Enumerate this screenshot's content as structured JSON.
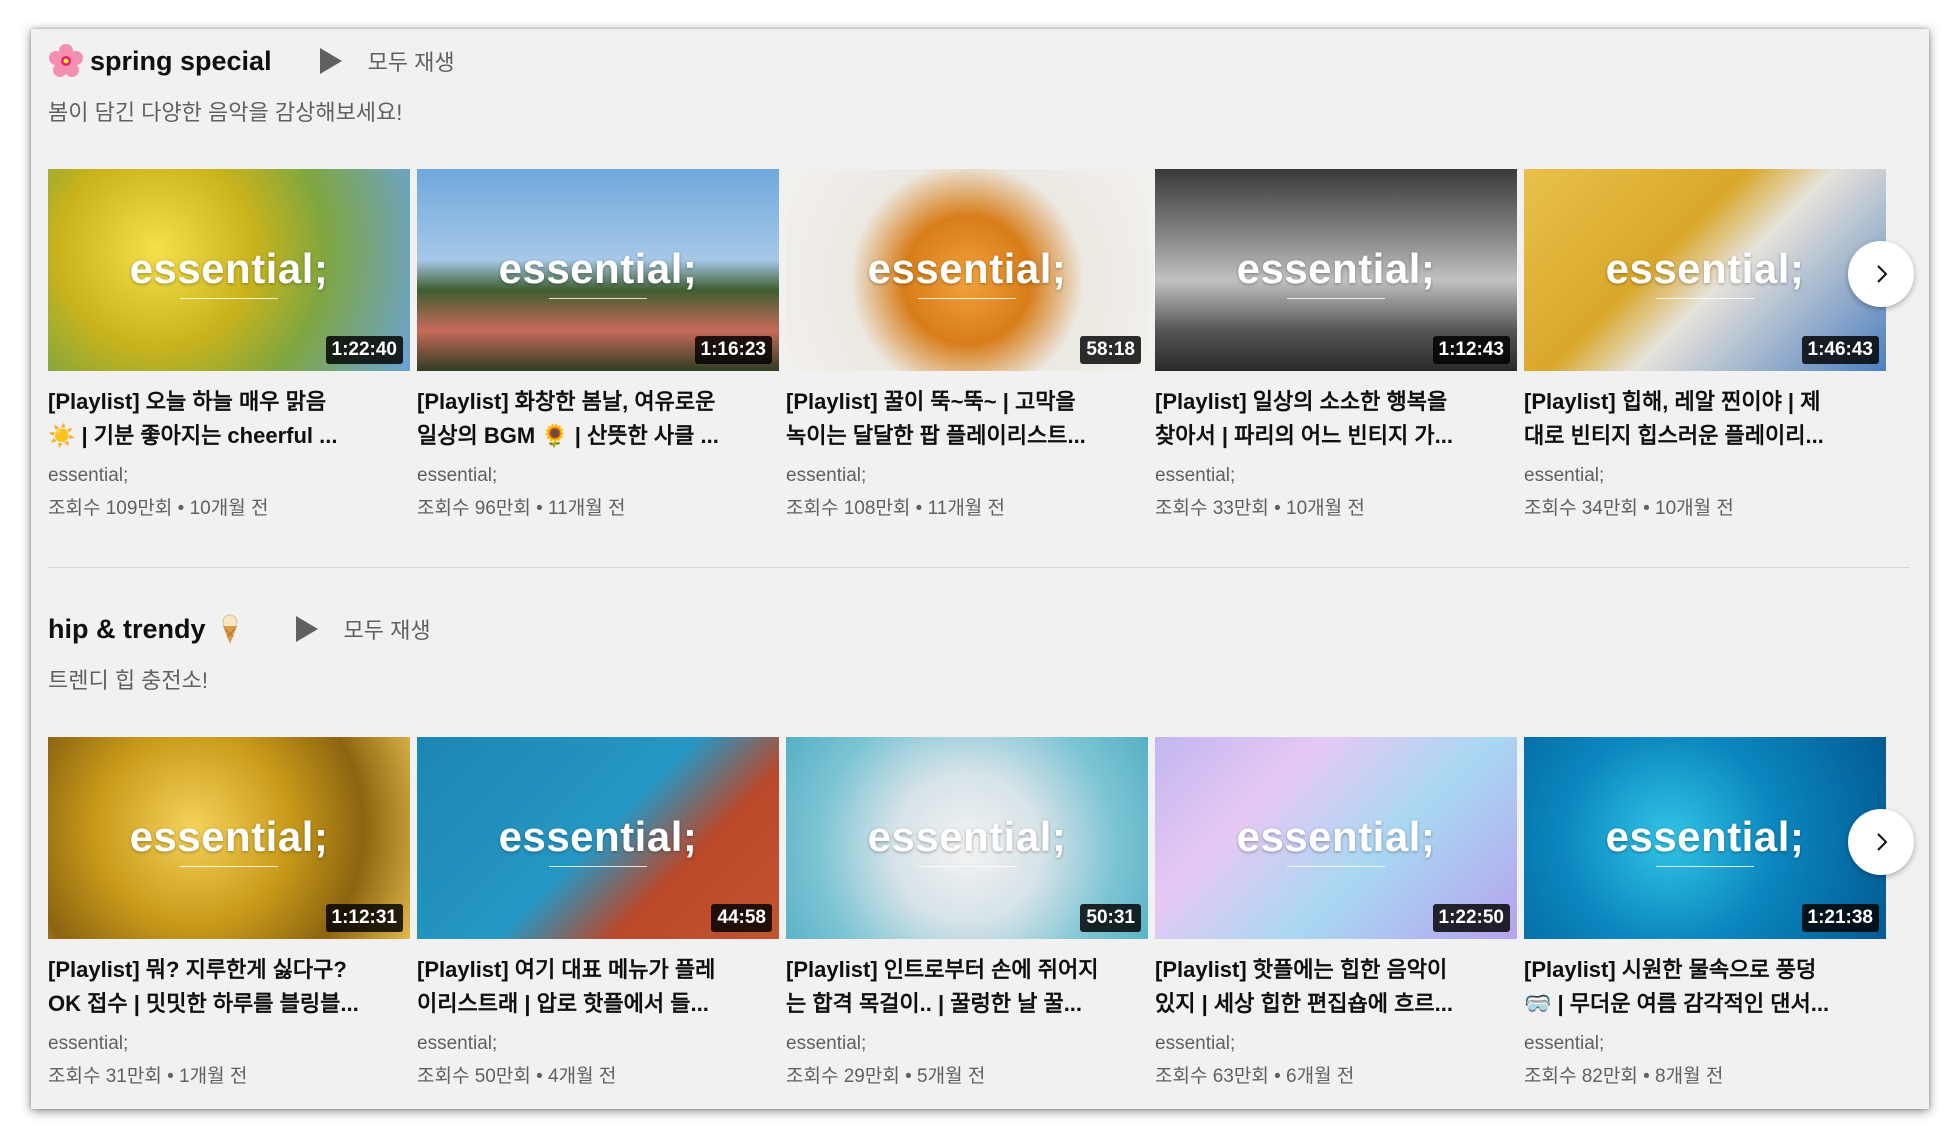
{
  "shelves": [
    {
      "title": "spring special",
      "title_emoji": "cherry-blossom-icon",
      "play_all_label": "모두 재생",
      "subtitle": "봄이 담긴 다양한 음악을 감상해보세요!",
      "videos": [
        {
          "thumb_text": "essential;",
          "duration": "1:22:40",
          "title_line1": "[Playlist] 오늘 하늘 매우 맑음",
          "title_line2": "☀️ | 기분 좋아지는 cheerful ...",
          "channel": "essential;",
          "meta": "조회수 109만회 • 10개월 전"
        },
        {
          "thumb_text": "essential;",
          "duration": "1:16:23",
          "title_line1": "[Playlist] 화창한 봄날, 여유로운",
          "title_line2": "일상의 BGM 🌻 | 산뜻한 사클 ...",
          "channel": "essential;",
          "meta": "조회수 96만회 • 11개월 전"
        },
        {
          "thumb_text": "essential;",
          "duration": "58:18",
          "title_line1": "[Playlist] 꿀이 뚝~뚝~ | 고막을",
          "title_line2": "녹이는 달달한 팝 플레이리스트...",
          "channel": "essential;",
          "meta": "조회수 108만회 • 11개월 전"
        },
        {
          "thumb_text": "essential;",
          "duration": "1:12:43",
          "title_line1": "[Playlist] 일상의 소소한 행복을",
          "title_line2": "찾아서 | 파리의 어느 빈티지 가...",
          "channel": "essential;",
          "meta": "조회수 33만회 • 10개월 전"
        },
        {
          "thumb_text": "essential;",
          "duration": "1:46:43",
          "title_line1": "[Playlist] 힙해, 레알 찐이야 | 제",
          "title_line2": "대로 빈티지 힙스러운 플레이리...",
          "channel": "essential;",
          "meta": "조회수 34만회 • 10개월 전"
        }
      ]
    },
    {
      "title": "hip & trendy",
      "title_emoji": "ice-cream-icon",
      "play_all_label": "모두 재생",
      "subtitle": "트렌디 힙 충전소!",
      "videos": [
        {
          "thumb_text": "essential;",
          "duration": "1:12:31",
          "title_line1": "[Playlist] 뭐? 지루한게 싫다구?",
          "title_line2": "OK 접수 | 밋밋한 하루를 블링블...",
          "channel": "essential;",
          "meta": "조회수 31만회 • 1개월 전"
        },
        {
          "thumb_text": "essential;",
          "duration": "44:58",
          "title_line1": "[Playlist] 여기 대표 메뉴가 플레",
          "title_line2": "이리스트래 | 압로 핫플에서 들...",
          "channel": "essential;",
          "meta": "조회수 50만회 • 4개월 전"
        },
        {
          "thumb_text": "essential;",
          "duration": "50:31",
          "title_line1": "[Playlist] 인트로부터 손에 쥐어지",
          "title_line2": "는 합격 목걸이.. | 꿀렁한 날 꿀...",
          "channel": "essential;",
          "meta": "조회수 29만회 • 5개월 전"
        },
        {
          "thumb_text": "essential;",
          "duration": "1:22:50",
          "title_line1": "[Playlist] 핫플에는 힙한 음악이",
          "title_line2": "있지 | 세상 힙한 편집숍에 흐르...",
          "channel": "essential;",
          "meta": "조회수 63만회 • 6개월 전"
        },
        {
          "thumb_text": "essential;",
          "duration": "1:21:38",
          "title_line1": "[Playlist] 시원한 물속으로 풍덩",
          "title_line2": "🥽 | 무더운 여름 감각적인 댄서...",
          "channel": "essential;",
          "meta": "조회수 82만회 • 8개월 전"
        }
      ]
    }
  ]
}
